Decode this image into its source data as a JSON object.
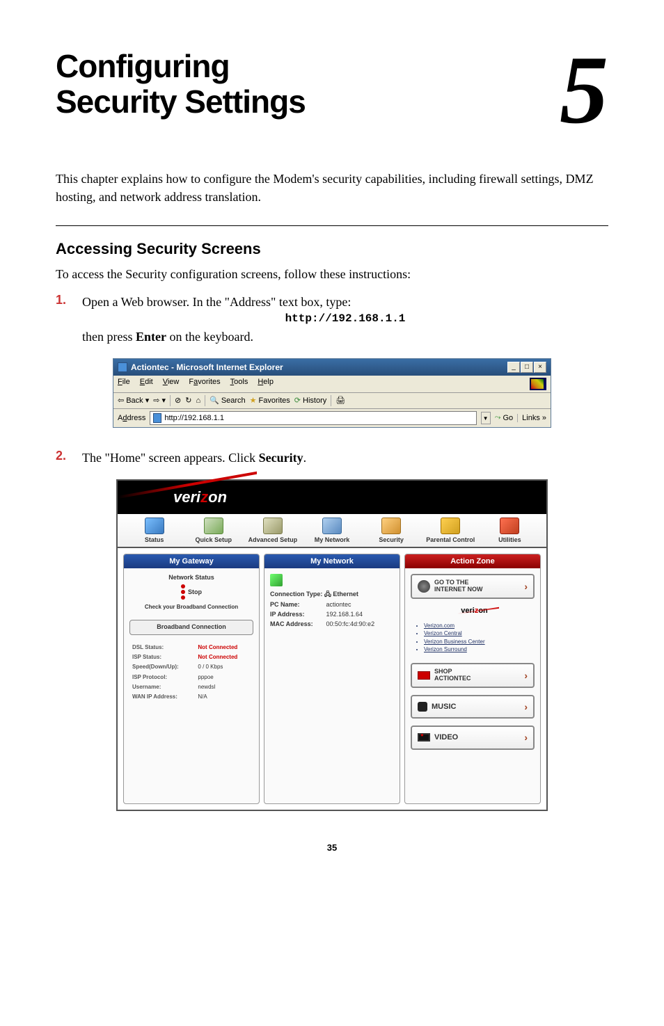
{
  "chapter": {
    "title_line1": "Configuring",
    "title_line2": "Security Settings",
    "number": "5"
  },
  "intro": "This chapter explains how to configure the Modem's security capabilities, including firewall settings, DMZ hosting, and network address translation.",
  "section": {
    "heading": "Accessing Security Screens",
    "body": "To access the Security configuration screens, follow these instructions:"
  },
  "steps": {
    "s1": {
      "num": "1.",
      "text_before_url": "Open a Web browser. In the \"Address\" text box, type:",
      "url": "http://192.168.1.1",
      "text_after_url_a": "then press ",
      "enter": "Enter",
      "text_after_url_b": " on the keyboard."
    },
    "s2": {
      "num": "2.",
      "text_a": "The \"Home\" screen appears. Click ",
      "security": "Security",
      "text_b": "."
    }
  },
  "ie": {
    "title": "Actiontec - Microsoft Internet Explorer",
    "btn_min": "_",
    "btn_max": "□",
    "btn_close": "×",
    "menu_file": "File",
    "menu_edit": "Edit",
    "menu_view": "View",
    "menu_favorites": "Favorites",
    "menu_tools": "Tools",
    "menu_help": "Help",
    "back": "Back",
    "search": "Search",
    "favorites": "Favorites",
    "history": "History",
    "addr_label": "Address",
    "addr_value": "http://192.168.1.1",
    "go": "Go",
    "links": "Links »"
  },
  "home": {
    "brand": {
      "a": "veri",
      "z": "z",
      "b": "on"
    },
    "nav": {
      "status": "Status",
      "quick": "Quick Setup",
      "advanced": "Advanced Setup",
      "network": "My Network",
      "security": "Security",
      "parental": "Parental Control",
      "utilities": "Utilities"
    },
    "gateway": {
      "title": "My Gateway",
      "netstat": "Network Status",
      "stop": "Stop",
      "check": "Check your Broadband Connection",
      "bbc": "Broadband Connection",
      "dsl_status_k": "DSL Status:",
      "dsl_status_v": "Not Connected",
      "isp_status_k": "ISP Status:",
      "isp_status_v": "Not Connected",
      "speed_k": "Speed(Down/Up):",
      "speed_v": "0 / 0 Kbps",
      "protocol_k": "ISP Protocol:",
      "protocol_v": "pppoe",
      "username_k": "Username:",
      "username_v": "newdsl",
      "wanip_k": "WAN IP Address:",
      "wanip_v": "N/A"
    },
    "mynet": {
      "title": "My Network",
      "conn_type_k": "Connection Type:",
      "conn_type_v": "Ethernet",
      "pcname_k": "PC Name:",
      "pcname_v": "actiontec",
      "ip_k": "IP Address:",
      "ip_v": "192.168.1.64",
      "mac_k": "MAC Address:",
      "mac_v": "00:50:fc:4d:90:e2"
    },
    "action": {
      "title": "Action Zone",
      "goto_a": "GO TO THE",
      "goto_b": "INTERNET NOW",
      "vz": {
        "a": "veri",
        "z": "z",
        "b": "on"
      },
      "links": {
        "l1": "Verizon.com",
        "l2": "Verizon Central",
        "l3": "Verizon Business Center",
        "l4": "Verizon Surround"
      },
      "shop_a": "SHOP",
      "shop_b": "ACTIONTEC",
      "music": "MUSIC",
      "video": "VIDEO"
    }
  },
  "page_num": "35"
}
